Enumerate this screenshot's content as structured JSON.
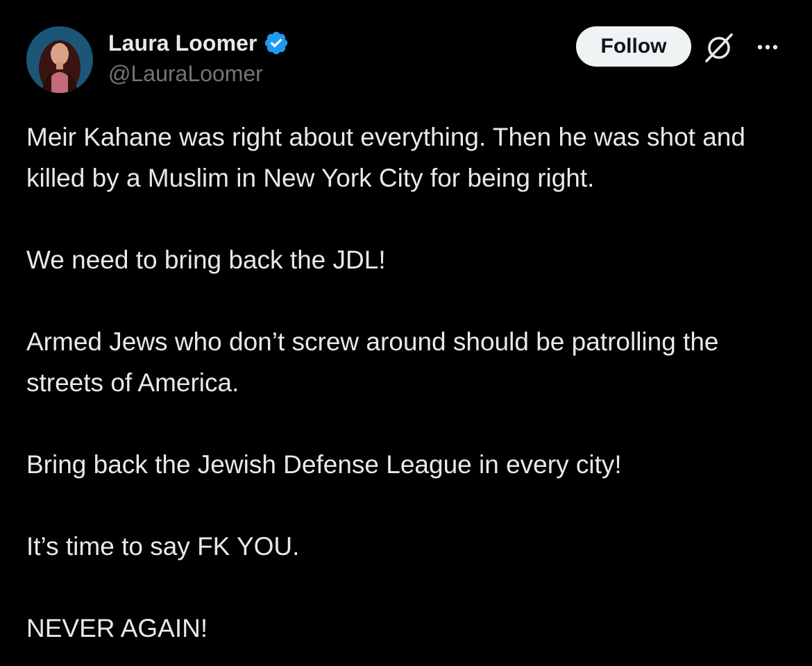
{
  "author": {
    "name": "Laura Loomer",
    "handle": "@LauraLoomer",
    "verified": true,
    "avatar_icon": "profile-photo"
  },
  "actions": {
    "follow_label": "Follow",
    "grok_icon": "slashed-circle-icon",
    "more_icon": "more-dots-icon"
  },
  "post": {
    "paragraphs": [
      "Meir Kahane was right about everything. Then he was shot and killed by a Muslim in New York City for being right.",
      "We need to bring back the JDL!",
      "Armed Jews who don’t screw around should be patrolling the streets of America.",
      "Bring back the Jewish Defense League in every city!",
      "It’s time to say FK YOU.",
      "NEVER AGAIN!"
    ]
  },
  "colors": {
    "background": "#000000",
    "text_primary": "#e7e9ea",
    "text_secondary": "#71767b",
    "verified_blue": "#1d9bf0",
    "follow_bg": "#eff3f4",
    "follow_text": "#0f1419"
  }
}
